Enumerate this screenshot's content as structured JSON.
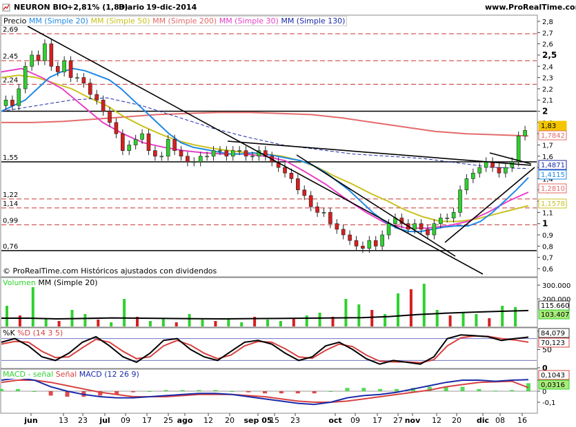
{
  "header": {
    "symbol": "NEURON BIO",
    "change": "+2,81% (1,83)",
    "period": "Diario",
    "date": "19-dic-2014",
    "site": "www.ProRealTime.com",
    "copyright": "© ProRealTime.com Históricos ajustados con dividendos"
  },
  "colors": {
    "up": "#2fd12f",
    "down": "#d61f1f",
    "ma20": "#1e88e5",
    "ma50": "#c9c21d",
    "ma200": "#e46a6a",
    "ma30": "#e83fc7",
    "ma130": "#1a2aa8",
    "hline_red": "#c83232",
    "stoch_k": "#000000",
    "stoch_d": "#d84040",
    "macd": "#1a2aa8",
    "signal": "#d84040"
  },
  "price_panel": {
    "legend": [
      "Precio",
      "MM (Simple 20)",
      "MM (Simple 50)",
      "MM (Simple 200)",
      "MM (Simple 30)",
      "MM (Simple 130)"
    ],
    "hline_labels": [
      "2,69",
      "2,45",
      "2,24",
      "1,55",
      "1,22",
      "1,14",
      "0,99",
      "0,76"
    ],
    "value_tags": [
      "1,83",
      "1,7842",
      "1,4871",
      "1,4115",
      "1,2810",
      "1,1578"
    ]
  },
  "volume_panel": {
    "legend": [
      "Volumen",
      "MM (Simple 20)"
    ],
    "value_tags": [
      "115.660",
      "103.407"
    ]
  },
  "stoch_panel": {
    "legend": [
      "%K",
      "%D (14 3 5)"
    ],
    "value_tags": [
      "84,079",
      "70,123"
    ]
  },
  "macd_panel": {
    "legend": [
      "MACD - señal",
      "Señal",
      "MACD (12 26 9)"
    ],
    "value_tags": [
      "0,1043",
      "0,0316"
    ]
  },
  "chart_data": {
    "type": "candlestick",
    "title": "NEURON BIO",
    "x": [
      "jun",
      "13",
      "23",
      "jul",
      "09",
      "17",
      "25",
      "ago",
      "12",
      "20",
      "sep 05",
      "15",
      "23",
      "oct",
      "09",
      "17",
      "27",
      "nov",
      "12",
      "20",
      "dic",
      "08",
      "16"
    ],
    "price_axis": {
      "ticks": [
        "2,8",
        "2,7",
        "2,6",
        "2,5",
        "2,4",
        "2,3",
        "2,2",
        "2,1",
        "2",
        "1,9",
        "1,8",
        "1,7",
        "1,6",
        "1,5",
        "1,4",
        "1,3",
        "1,2",
        "1,1",
        "1",
        "0,9",
        "0,8",
        "0,7",
        "0,6"
      ],
      "ylim": [
        0.55,
        2.85
      ]
    },
    "volume_axis": {
      "ticks": [
        "300.000",
        "200.000"
      ]
    },
    "stoch_axis": {
      "ticks": [
        "100",
        "50",
        "0"
      ]
    },
    "macd_axis": {
      "ticks": [
        "0,1",
        "0",
        "-0,1"
      ]
    },
    "close_series": [
      2.1,
      2.05,
      2.2,
      2.4,
      2.5,
      2.45,
      2.6,
      2.4,
      2.35,
      2.45,
      2.3,
      2.3,
      2.25,
      2.15,
      2.1,
      2.0,
      1.9,
      1.8,
      1.65,
      1.7,
      1.75,
      1.8,
      1.65,
      1.6,
      1.6,
      1.75,
      1.65,
      1.6,
      1.55,
      1.55,
      1.6,
      1.6,
      1.65,
      1.65,
      1.6,
      1.65,
      1.65,
      1.6,
      1.6,
      1.65,
      1.6,
      1.55,
      1.5,
      1.45,
      1.4,
      1.3,
      1.25,
      1.15,
      1.1,
      1.1,
      1.0,
      0.95,
      0.9,
      0.85,
      0.8,
      0.78,
      0.85,
      0.8,
      0.9,
      1.0,
      1.05,
      1.0,
      0.95,
      1.0,
      0.95,
      0.9,
      1.0,
      1.05,
      1.05,
      1.1,
      1.3,
      1.4,
      1.45,
      1.5,
      1.55,
      1.5,
      1.45,
      1.5,
      1.55,
      1.78,
      1.83
    ],
    "ma20": [
      2.0,
      2.05,
      2.1,
      2.2,
      2.3,
      2.35,
      2.38,
      2.36,
      2.32,
      2.28,
      2.2,
      2.1,
      2.0,
      1.9,
      1.8,
      1.72,
      1.68,
      1.66,
      1.64,
      1.62,
      1.62,
      1.63,
      1.62,
      1.6,
      1.58,
      1.56,
      1.52,
      1.46,
      1.38,
      1.3,
      1.2,
      1.1,
      1.02,
      0.96,
      0.93,
      0.93,
      0.95,
      0.97,
      0.98,
      0.98,
      1.02,
      1.1,
      1.2,
      1.3,
      1.41
    ],
    "ma50": [
      2.3,
      2.32,
      2.3,
      2.25,
      2.2,
      2.12,
      2.05,
      1.95,
      1.87,
      1.8,
      1.74,
      1.7,
      1.67,
      1.65,
      1.63,
      1.62,
      1.6,
      1.56,
      1.5,
      1.42,
      1.35,
      1.27,
      1.2,
      1.12,
      1.06,
      1.02,
      1.02,
      1.04,
      1.08,
      1.12,
      1.16
    ],
    "ma200": [
      1.9,
      1.9,
      1.91,
      1.93,
      1.95,
      1.97,
      1.98,
      1.99,
      1.99,
      1.98,
      1.97,
      1.94,
      1.9,
      1.86,
      1.82,
      1.8,
      1.79,
      1.78
    ],
    "ma30": [
      2.35,
      2.38,
      2.3,
      2.2,
      2.05,
      1.9,
      1.8,
      1.72,
      1.68,
      1.65,
      1.63,
      1.62,
      1.62,
      1.6,
      1.56,
      1.46,
      1.35,
      1.22,
      1.1,
      1.0,
      0.96,
      0.96,
      0.98,
      1.02,
      1.1,
      1.2,
      1.28
    ],
    "ma130": [
      2.0,
      2.05,
      2.1,
      2.12,
      2.05,
      1.95,
      1.85,
      1.77,
      1.7,
      1.66,
      1.62,
      1.6,
      1.58,
      1.54,
      1.5,
      1.49
    ],
    "volume": [
      150000,
      80000,
      300000,
      60000,
      40000,
      120000,
      90000,
      50000,
      30000,
      200000,
      70000,
      40000,
      60000,
      30000,
      90000,
      50000,
      40000,
      60000,
      30000,
      70000,
      50000,
      40000,
      60000,
      80000,
      100000,
      70000,
      200000,
      160000,
      120000,
      90000,
      240000,
      270000,
      310000,
      120000,
      80000,
      100000,
      90000,
      60000,
      150000,
      140000
    ],
    "volume_ma20": [
      60000,
      60000,
      55000,
      58000,
      62000,
      60000,
      58000,
      56000,
      55000,
      57000,
      58000,
      60000,
      62000,
      64000,
      72000,
      86000,
      96000,
      104000,
      110000,
      115660
    ],
    "stoch_k": [
      70,
      80,
      60,
      30,
      20,
      40,
      70,
      85,
      60,
      30,
      15,
      40,
      75,
      80,
      50,
      30,
      20,
      45,
      70,
      75,
      65,
      40,
      20,
      30,
      60,
      70,
      50,
      25,
      10,
      20,
      15,
      10,
      30,
      80,
      90,
      88,
      85,
      75,
      80,
      84
    ],
    "stoch_d": [
      65,
      72,
      70,
      45,
      28,
      30,
      55,
      78,
      70,
      45,
      25,
      30,
      60,
      75,
      62,
      40,
      25,
      35,
      60,
      72,
      70,
      52,
      30,
      26,
      48,
      65,
      58,
      35,
      18,
      16,
      16,
      14,
      22,
      60,
      82,
      87,
      86,
      80,
      76,
      70
    ],
    "macd": [
      0.1,
      0.12,
      0.1,
      0.04,
      0.0,
      -0.03,
      -0.05,
      -0.06,
      -0.06,
      -0.05,
      -0.04,
      -0.03,
      -0.02,
      -0.02,
      -0.03,
      -0.05,
      -0.07,
      -0.09,
      -0.11,
      -0.12,
      -0.1,
      -0.06,
      -0.04,
      -0.03,
      -0.01,
      0.02,
      0.05,
      0.08,
      0.1,
      0.1,
      0.09,
      0.1,
      0.1043
    ],
    "signal": [
      0.08,
      0.1,
      0.1,
      0.08,
      0.05,
      0.02,
      -0.01,
      -0.03,
      -0.05,
      -0.05,
      -0.05,
      -0.04,
      -0.03,
      -0.03,
      -0.03,
      -0.04,
      -0.05,
      -0.07,
      -0.09,
      -0.1,
      -0.1,
      -0.09,
      -0.07,
      -0.05,
      -0.03,
      -0.01,
      0.01,
      0.04,
      0.06,
      0.08,
      0.085,
      0.09,
      0.0316
    ]
  }
}
